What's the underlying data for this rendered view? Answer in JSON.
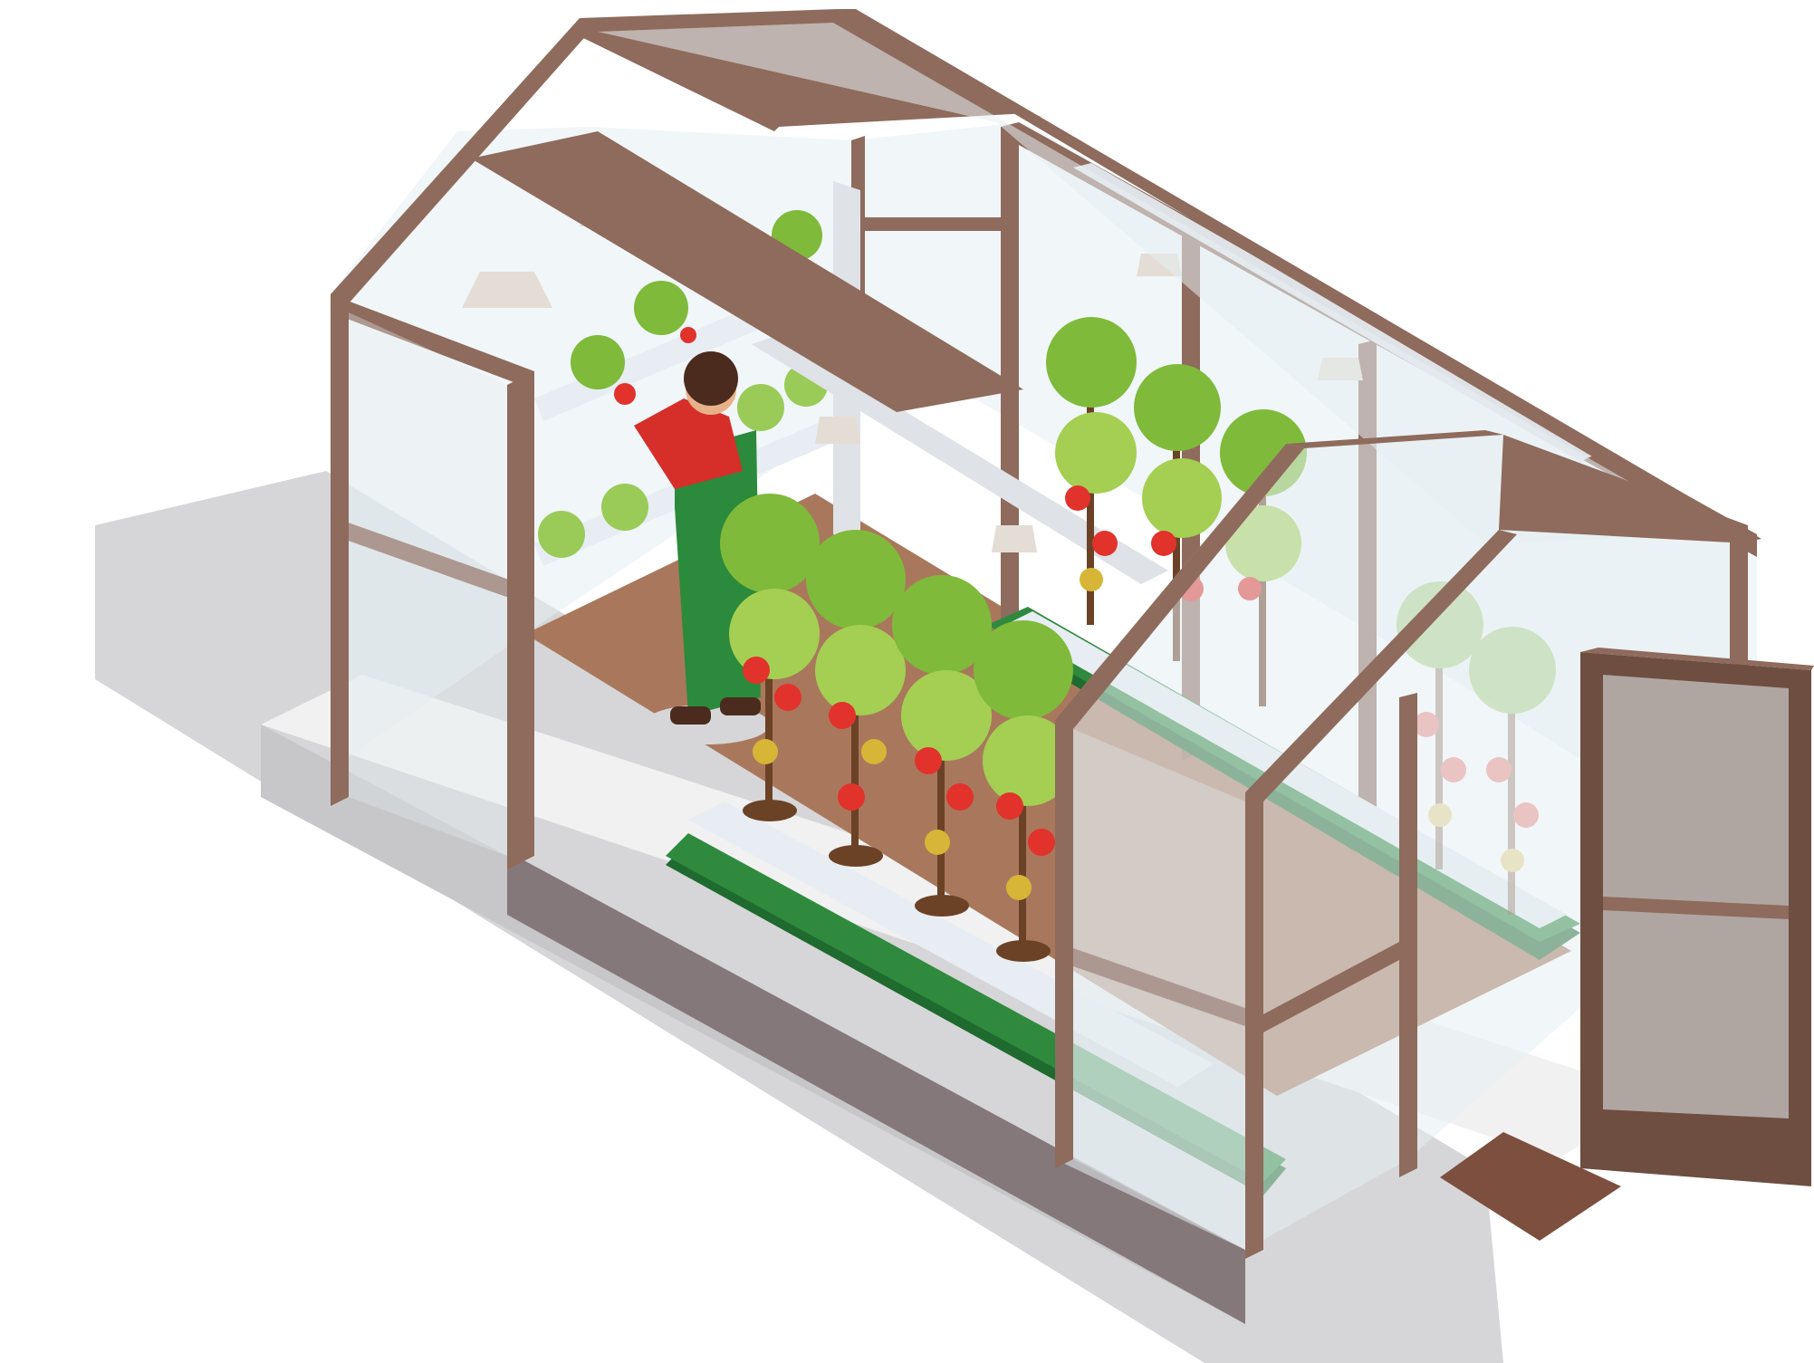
{
  "palette": {
    "background": "#ffffff",
    "shadow": "#d6d6d8",
    "plinth_top": "#f1f1f2",
    "plinth_left": "#c7c7ca",
    "plinth_front": "#85787a",
    "frame": "#8e6b5c",
    "frame_dark": "#6e4e41",
    "floor": "#a9785c",
    "floor_dark": "#7d4f3f",
    "glass": "#e6eef2",
    "tray": "#2f8a3e",
    "tray_dark": "#1f6a2e",
    "channel": "#e7edf2",
    "pipe": "#dfe2e6",
    "lamp": "#e4ddd5",
    "leaf": "#7fba3a",
    "leaf_light": "#a4cf52",
    "stem": "#6b4226",
    "tomato_red": "#e2322c",
    "tomato_yellow": "#d7b536",
    "lettuce": "#9acb58",
    "shirt": "#d62f2a",
    "overalls": "#2b8a3b",
    "hair": "#4a2b1e",
    "skin": "#e7b189"
  },
  "icons": [
    "greenhouse-icon",
    "gardener-icon",
    "tomato-plant-icon",
    "lettuce-icon",
    "grow-lamp-icon",
    "pipe-icon",
    "open-door-icon"
  ]
}
